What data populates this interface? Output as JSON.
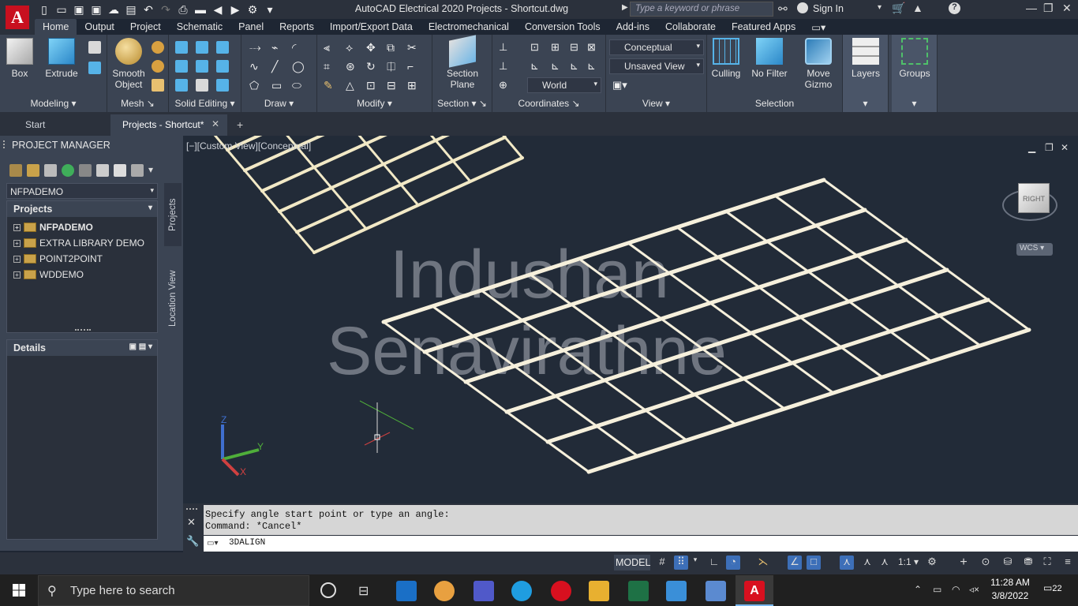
{
  "window": {
    "title": "AutoCAD Electrical 2020   Projects - Shortcut.dwg",
    "search_placeholder": "Type a keyword or phrase",
    "sign_in": "Sign In"
  },
  "app_button": {
    "letter": "A",
    "sub": "E"
  },
  "ribbon_tabs": [
    "Home",
    "Output",
    "Project",
    "Schematic",
    "Panel",
    "Reports",
    "Import/Export Data",
    "Electromechanical",
    "Conversion Tools",
    "Add-ins",
    "Collaborate",
    "Featured Apps"
  ],
  "ribbon": {
    "box": "Box",
    "extrude": "Extrude",
    "smooth": "Smooth Object",
    "section_plane": "Section Plane",
    "culling": "Culling",
    "no_filter": "No Filter",
    "move_gizmo": "Move Gizmo",
    "layers": "Layers",
    "groups": "Groups",
    "visual_style": "Conceptual",
    "view_name": "Unsaved View",
    "ucs": "World",
    "panels": {
      "modeling": "Modeling",
      "mesh": "Mesh",
      "solid_editing": "Solid Editing",
      "draw": "Draw",
      "modify": "Modify",
      "section": "Section",
      "coordinates": "Coordinates",
      "view": "View",
      "selection": "Selection"
    }
  },
  "doc_tabs": {
    "start": "Start",
    "current": "Projects - Shortcut*"
  },
  "project_manager": {
    "title": "PROJECT MANAGER",
    "selected_project": "NFPADEMO",
    "projects_header": "Projects",
    "projects": [
      "NFPADEMO",
      "EXTRA LIBRARY DEMO",
      "POINT2POINT",
      "WDDEMO"
    ],
    "details_header": "Details",
    "side_tabs": [
      "Projects",
      "Location View"
    ]
  },
  "viewport": {
    "label": "[−][Custom View][Conceptual]",
    "watermark_line1": "Indushan",
    "watermark_line2": "Senavirathne",
    "viewcube_face": "RIGHT",
    "wcs": "WCS"
  },
  "command": {
    "history": [
      "Specify angle start point or type an angle:",
      "Command: *Cancel*"
    ],
    "input": "3DALIGN"
  },
  "status": {
    "model": "MODEL",
    "scale": "1:1"
  },
  "taskbar": {
    "search": "Type here to search",
    "time": "11:28 AM",
    "date": "3/8/2022",
    "notifications": "22"
  }
}
